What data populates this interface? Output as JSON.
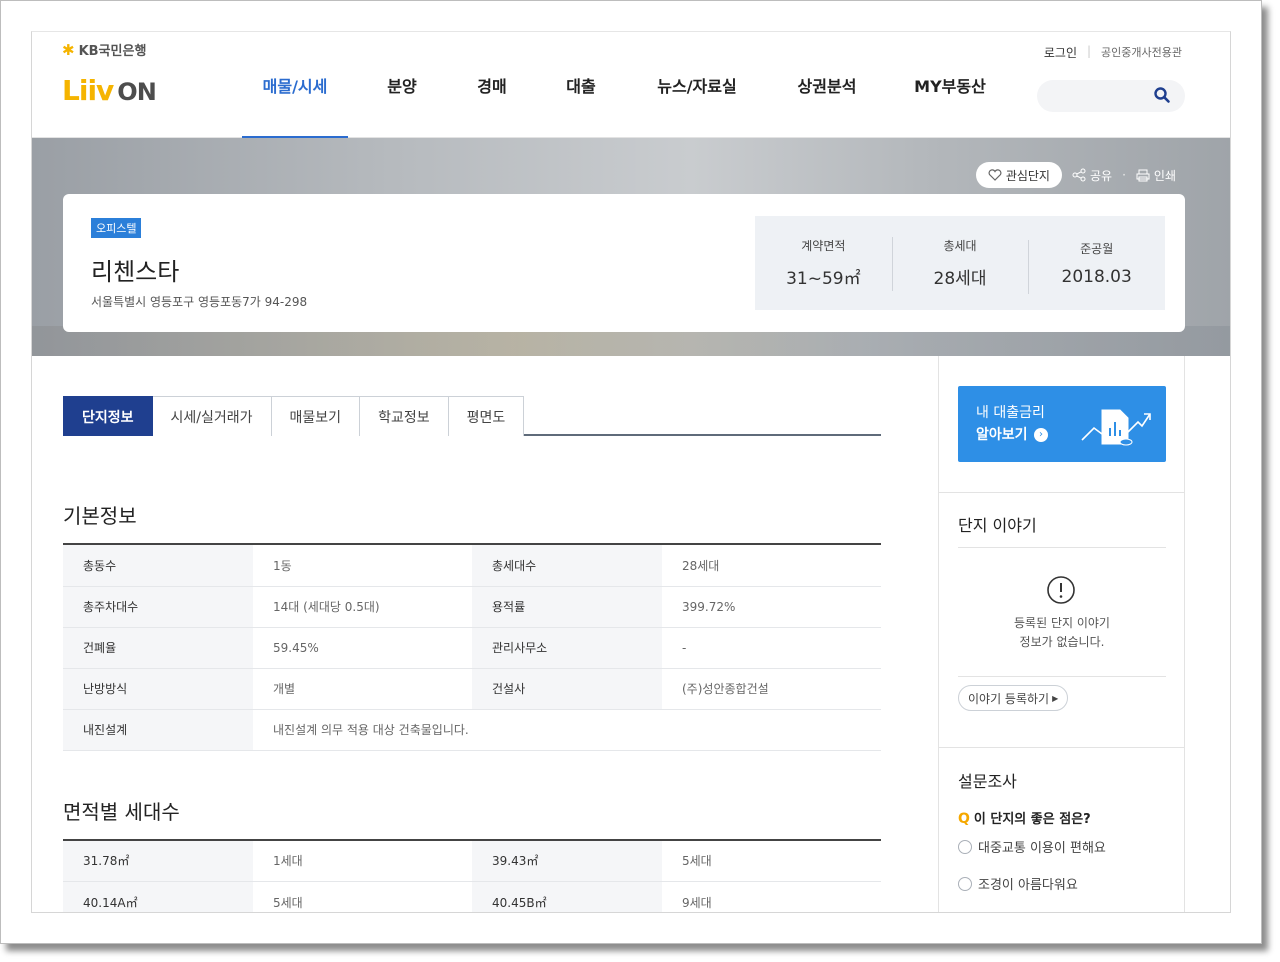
{
  "header": {
    "kb_logo": "KB국민은행",
    "liiv_logo": "Liiv",
    "liiv_on": "ON",
    "login": "로그인",
    "broker": "공인중개사전용관",
    "nav": [
      "매물/시세",
      "분양",
      "경매",
      "대출",
      "뉴스/자료실",
      "상권분석",
      "MY부동산"
    ],
    "search_placeholder": ""
  },
  "hero": {
    "favorite": "관심단지",
    "share": "공유",
    "print": "인쇄",
    "badge": "오피스텔",
    "name": "리첸스타",
    "address": "서울특별시 영등포구 영등포동7가 94-298",
    "stats": [
      {
        "label": "계약면적",
        "value": "31~59㎡"
      },
      {
        "label": "총세대",
        "value": "28세대"
      },
      {
        "label": "준공월",
        "value": "2018.03"
      }
    ]
  },
  "tabs": [
    "단지정보",
    "시세/실거래가",
    "매물보기",
    "학교정보",
    "평면도"
  ],
  "basic_info": {
    "title": "기본정보",
    "rows": [
      {
        "k1": "총동수",
        "v1": "1동",
        "k2": "총세대수",
        "v2": "28세대"
      },
      {
        "k1": "총주차대수",
        "v1": "14대 (세대당 0.5대)",
        "k2": "용적률",
        "v2": "399.72%"
      },
      {
        "k1": "건폐율",
        "v1": "59.45%",
        "k2": "관리사무소",
        "v2": "-"
      },
      {
        "k1": "난방방식",
        "v1": "개별",
        "k2": "건설사",
        "v2": "(주)성안종합건설"
      }
    ],
    "seismic_label": "내진설계",
    "seismic_value": "내진설계 의무 적용 대상 건축물입니다."
  },
  "area_units": {
    "title": "면적별 세대수",
    "rows": [
      {
        "k1": "31.78㎡",
        "v1": "1세대",
        "k2": "39.43㎡",
        "v2": "5세대"
      },
      {
        "k1": "40.14A㎡",
        "v1": "5세대",
        "k2": "40.45B㎡",
        "v2": "9세대"
      }
    ]
  },
  "sidebar": {
    "loan_line1": "내 대출금리",
    "loan_line2": "알아보기",
    "story_title": "단지 이야기",
    "story_empty_1": "등록된 단지 이야기",
    "story_empty_2": "정보가 없습니다.",
    "story_button": "이야기 등록하기",
    "survey_title": "설문조사",
    "survey_q": "이 단지의 좋은 점은?",
    "survey_options": [
      "대중교통 이용이 편해요",
      "조경이 아름다워요"
    ]
  },
  "colors": {
    "accent": "#2b6ccf",
    "tab_active": "#1f3f8f",
    "banner": "#2e8fe6",
    "badge": "#2b7fd9",
    "logo_yellow": "#f5b400"
  }
}
